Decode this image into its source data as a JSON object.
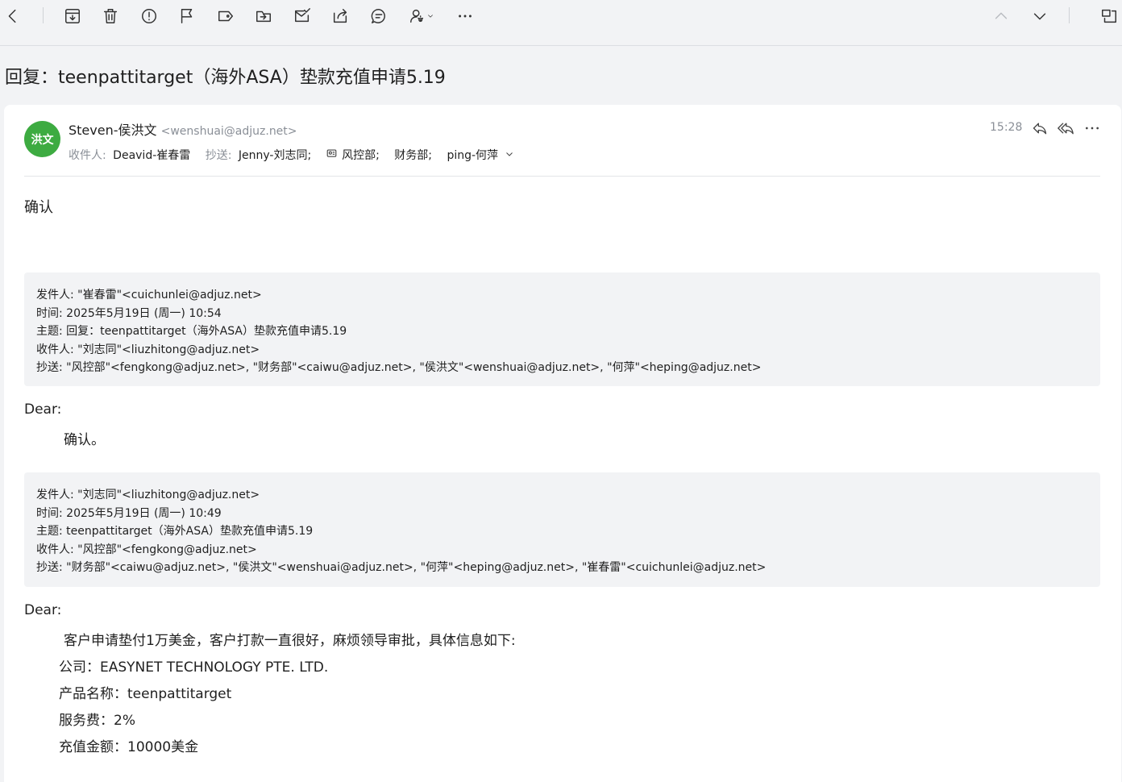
{
  "subject": "回复：teenpattitarget（海外ASA）垫款充值申请5.19",
  "header": {
    "avatar_text": "洪文",
    "avatar_color": "#3dab41",
    "sender_name": "Steven-侯洪文",
    "sender_email": "<wenshuai@adjuz.net>",
    "time": "15:28",
    "to_label": "收件人:",
    "to": "Deavid-崔春雷",
    "cc_label": "抄送:",
    "cc": [
      "Jenny-刘志同;",
      "风控部;",
      "财务部;",
      "ping-何萍"
    ]
  },
  "body": {
    "reply_text": "确认",
    "quote1": {
      "from": "发件人: \"崔春雷\"<cuichunlei@adjuz.net>",
      "time": "时间:  2025年5月19日 (周一) 10:54",
      "subject": "主题:  回复：teenpattitarget（海外ASA）垫款充值申请5.19",
      "to": "收件人: \"刘志同\"<liuzhitong@adjuz.net>",
      "cc": "抄送: \"风控部\"<fengkong@adjuz.net>, \"财务部\"<caiwu@adjuz.net>, \"侯洪文\"<wenshuai@adjuz.net>, \"何萍\"<heping@adjuz.net>"
    },
    "dear1": "Dear:",
    "confirm1": "确认。",
    "quote2": {
      "from": "发件人: \"刘志同\"<liuzhitong@adjuz.net>",
      "time": "时间:  2025年5月19日 (周一) 10:49",
      "subject": "主题:  teenpattitarget（海外ASA）垫款充值申请5.19",
      "to": "收件人: \"风控部\"<fengkong@adjuz.net>",
      "cc": "抄送: \"财务部\"<caiwu@adjuz.net>, \"侯洪文\"<wenshuai@adjuz.net>, \"何萍\"<heping@adjuz.net>, \"崔春雷\"<cuichunlei@adjuz.net>"
    },
    "dear2": "Dear:",
    "request": "客户申请垫付1万美金，客户打款一直很好，麻烦领导审批，具体信息如下:",
    "company": "公司：EASYNET TECHNOLOGY PTE. LTD.",
    "product": "产品名称：teenpattitarget",
    "fee": "服务费：2%",
    "amount": "充值金额：10000美金"
  }
}
